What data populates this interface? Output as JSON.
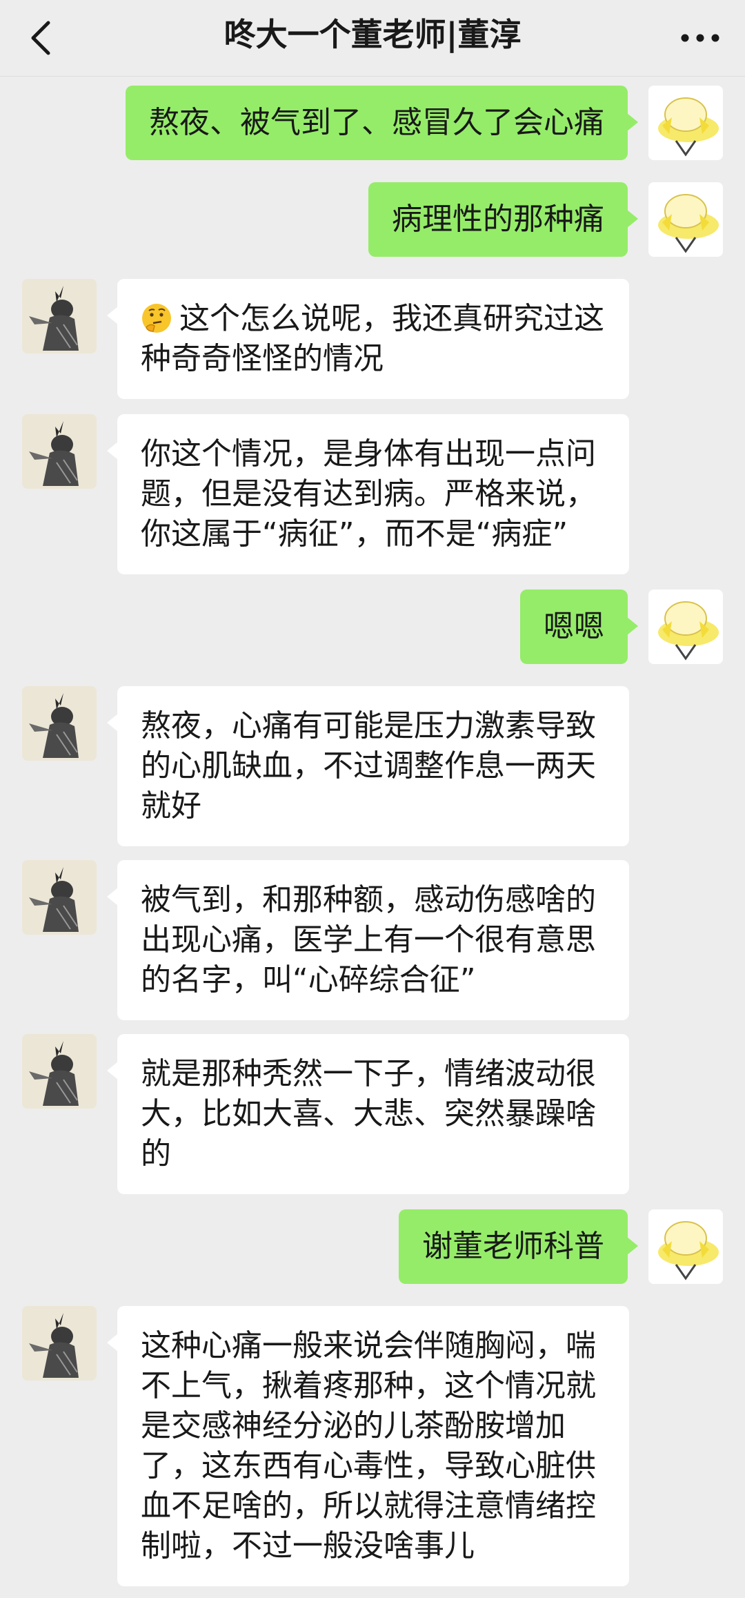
{
  "header": {
    "title": "咚大一个董老师|董淳"
  },
  "colors": {
    "background": "#ededed",
    "my_bubble": "#95ec69",
    "their_bubble": "#ffffff"
  },
  "icons": {
    "back": "back-chevron-icon",
    "more": "more-dots-icon",
    "emoji": "thinking-face-emoji"
  },
  "messages": [
    {
      "from": "me",
      "text": "熬夜、被气到了、感冒久了会心痛"
    },
    {
      "from": "me",
      "text": "病理性的那种痛"
    },
    {
      "from": "them",
      "text": "这个怎么说呢，我还真研究过这种奇奇怪怪的情况"
    },
    {
      "from": "them",
      "text": "你这个情况，是身体有出现一点问题，但是没有达到病。严格来说，你这属于“病征”，而不是“病症”"
    },
    {
      "from": "me",
      "text": "嗯嗯"
    },
    {
      "from": "them",
      "text": "熬夜，心痛有可能是压力激素导致的心肌缺血，不过调整作息一两天就好"
    },
    {
      "from": "them",
      "text": "被气到，和那种额，感动伤感啥的出现心痛，医学上有一个很有意思的名字，叫“心碎综合征”"
    },
    {
      "from": "them",
      "text": "就是那种秃然一下子，情绪波动很大，比如大喜、大悲、突然暴躁啥的"
    },
    {
      "from": "me",
      "text": "谢董老师科普"
    },
    {
      "from": "them",
      "text": "这种心痛一般来说会伴随胸闷，喘不上气，揪着疼那种，这个情况就是交感神经分泌的儿茶酚胺增加了，这东西有心毒性，导致心脏供血不足啥的，所以就得注意情绪控制啦，不过一般没啥事儿"
    }
  ]
}
